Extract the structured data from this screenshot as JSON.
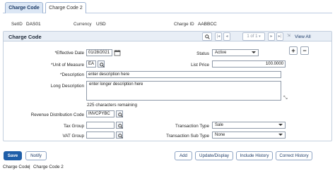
{
  "tabs": [
    {
      "label": "Charge Code"
    },
    {
      "label": "Charge Code 2"
    }
  ],
  "header": {
    "setid_label": "SetID",
    "setid_value": "DAS01",
    "currency_label": "Currency",
    "currency_value": "USD",
    "charge_id_label": "Charge ID",
    "charge_id_value": "AABBCC"
  },
  "panel": {
    "title": "Charge Code",
    "pager": "1 of 1",
    "view_all": "View All"
  },
  "form": {
    "effective_date_label": "*Effective Date",
    "effective_date_value": "01/28/2021",
    "status_label": "Status",
    "status_value": "Active",
    "uom_label": "*Unit of Measure",
    "uom_value": "EA",
    "list_price_label": "List Price",
    "list_price_value": "100.0000",
    "description_label": "*Description",
    "description_value": "enter description here",
    "long_desc_label": "Long Description",
    "long_desc_value": "enter longer description here",
    "chars_remaining": "225 characters remaining",
    "rev_dist_label": "Revenue Distribution Code",
    "rev_dist_value": "INVCPYBC",
    "tax_group_label": "Tax Group",
    "tax_group_value": "",
    "txn_type_label": "Transaction Type",
    "txn_type_value": "Sale",
    "vat_group_label": "VAT Group",
    "vat_group_value": "",
    "txn_subtype_label": "Transaction Sub Type",
    "txn_subtype_value": "None"
  },
  "buttons": {
    "save": "Save",
    "notify": "Notify",
    "add": "Add",
    "update_display": "Update/Display",
    "include_history": "Include History",
    "correct_history": "Correct History",
    "add_row": "+",
    "delete_row": "−"
  },
  "footer": {
    "items": [
      "Charge Code",
      "Charge Code 2"
    ],
    "separator": "|"
  },
  "colors": {
    "primary_button": "#1f5ea8",
    "panel_header": "#e8eef6",
    "link": "#1d3b68"
  }
}
